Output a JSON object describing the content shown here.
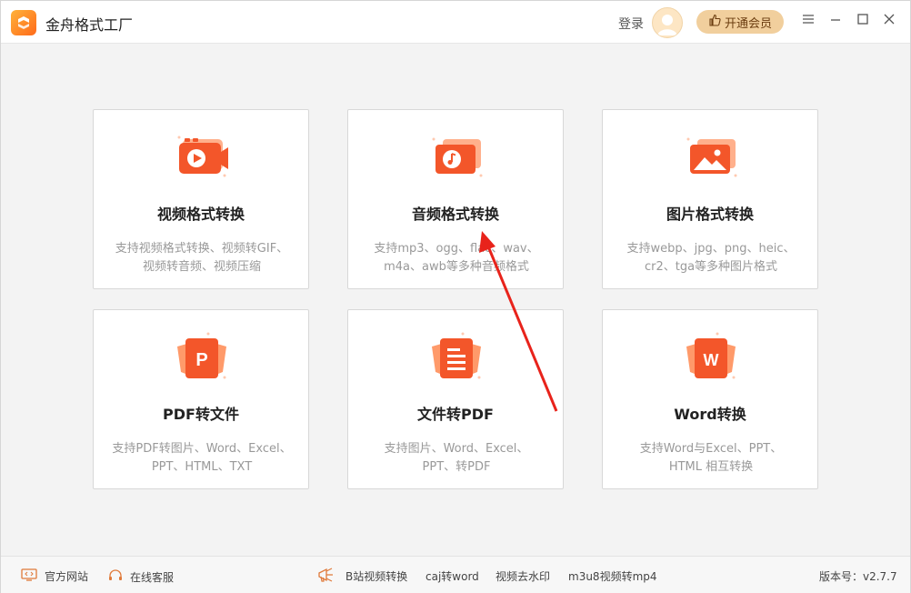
{
  "app": {
    "title": "金舟格式工厂"
  },
  "header": {
    "login": "登录",
    "vip_button": "开通会员"
  },
  "cards": [
    {
      "title": "视频格式转换",
      "desc1": "支持视频格式转换、视频转GIF、",
      "desc2": "视频转音频、视频压缩",
      "icon": "video-icon"
    },
    {
      "title": "音频格式转换",
      "desc1": "支持mp3、ogg、flac、wav、",
      "desc2": "m4a、awb等多种音频格式",
      "icon": "audio-icon"
    },
    {
      "title": "图片格式转换",
      "desc1": "支持webp、jpg、png、heic、",
      "desc2": "cr2、tga等多种图片格式",
      "icon": "image-icon"
    },
    {
      "title": "PDF转文件",
      "desc1": "支持PDF转图片、Word、Excel、",
      "desc2": "PPT、HTML、TXT",
      "icon": "pdf-icon",
      "glyph": "P"
    },
    {
      "title": "文件转PDF",
      "desc1": "支持图片、Word、Excel、",
      "desc2": "PPT、转PDF",
      "icon": "document-icon"
    },
    {
      "title": "Word转换",
      "desc1": "支持Word与Excel、PPT、",
      "desc2": "HTML 相互转换",
      "icon": "word-icon",
      "glyph": "W"
    }
  ],
  "footer": {
    "official_site": "官方网站",
    "online_service": "在线客服",
    "links": [
      "B站视频转换",
      "caj转word",
      "视频去水印",
      "m3u8视频转mp4"
    ],
    "version": "版本号：v2.7.7"
  },
  "colors": {
    "accent": "#f3562a",
    "accent_light": "#ff9a6a",
    "vip": "#f1cf9d",
    "arrow": "#e8231b"
  }
}
